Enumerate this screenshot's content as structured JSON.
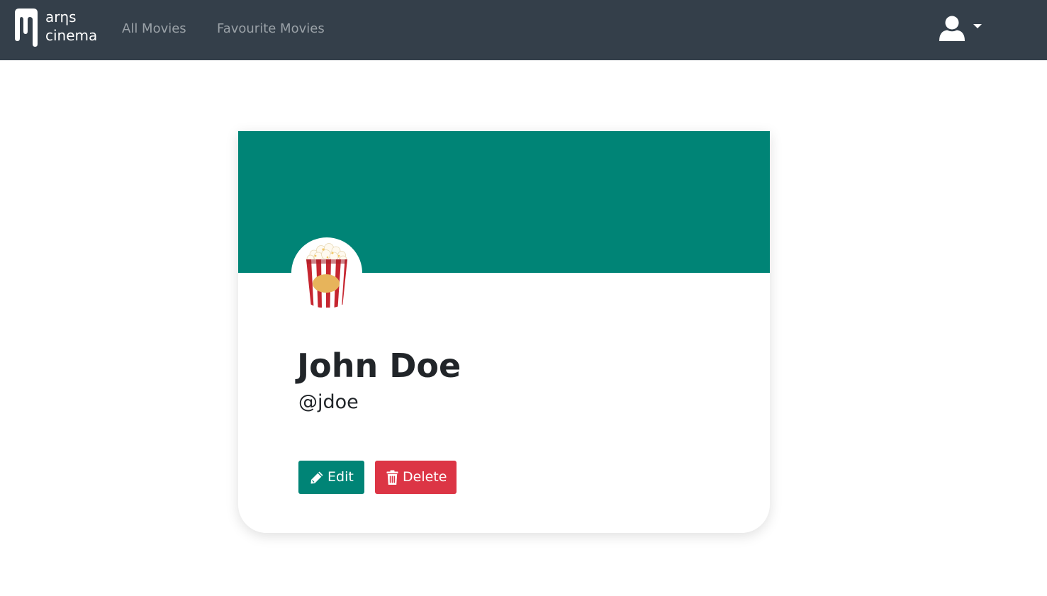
{
  "brand": {
    "line1": "arηs",
    "line2": "cinema",
    "logo_icon": "film-drip-logo"
  },
  "nav": {
    "all_movies": "All Movies",
    "favourite_movies": "Favourite Movies",
    "user_icon": "user-icon",
    "caret_icon": "caret-down-icon"
  },
  "profile": {
    "name": "John Doe",
    "handle": "@jdoe",
    "avatar_icon": "popcorn-icon"
  },
  "actions": {
    "edit_label": "Edit",
    "edit_icon": "pencil-icon",
    "delete_label": "Delete",
    "delete_icon": "trash-icon"
  },
  "colors": {
    "navbar": "#343f4a",
    "accent": "#008476",
    "danger": "#dc3545",
    "nav_link": "#9aa1a7"
  }
}
